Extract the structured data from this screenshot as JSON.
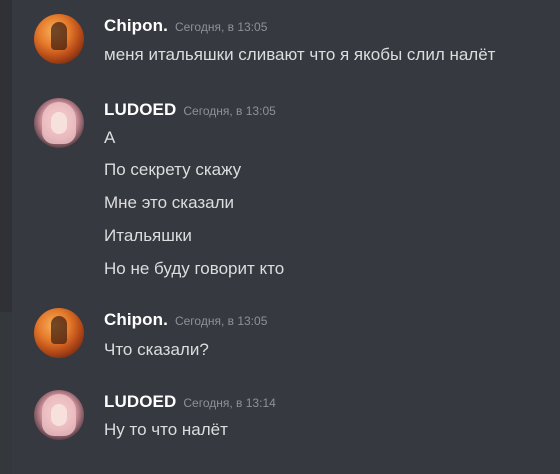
{
  "messages": [
    {
      "username": "Chipon.",
      "timestamp": "Сегодня, в 13:05",
      "lines": [
        "меня итальяшки сливают что я якобы слил налёт"
      ]
    },
    {
      "username": "LUDOED",
      "timestamp": "Сегодня, в 13:05",
      "lines": [
        "А",
        "По секрету скажу",
        "Мне это сказали",
        "Итальяшки",
        "Но не буду говорит кто"
      ]
    },
    {
      "username": "Chipon.",
      "timestamp": "Сегодня, в 13:05",
      "lines": [
        "Что сказали?"
      ]
    },
    {
      "username": "LUDOED",
      "timestamp": "Сегодня, в 13:14",
      "lines": [
        "Ну то что налёт"
      ]
    }
  ],
  "colors": {
    "background": "#36393f",
    "username": "#ffffff",
    "message_text": "#dcddde",
    "timestamp": "#8e9297"
  }
}
